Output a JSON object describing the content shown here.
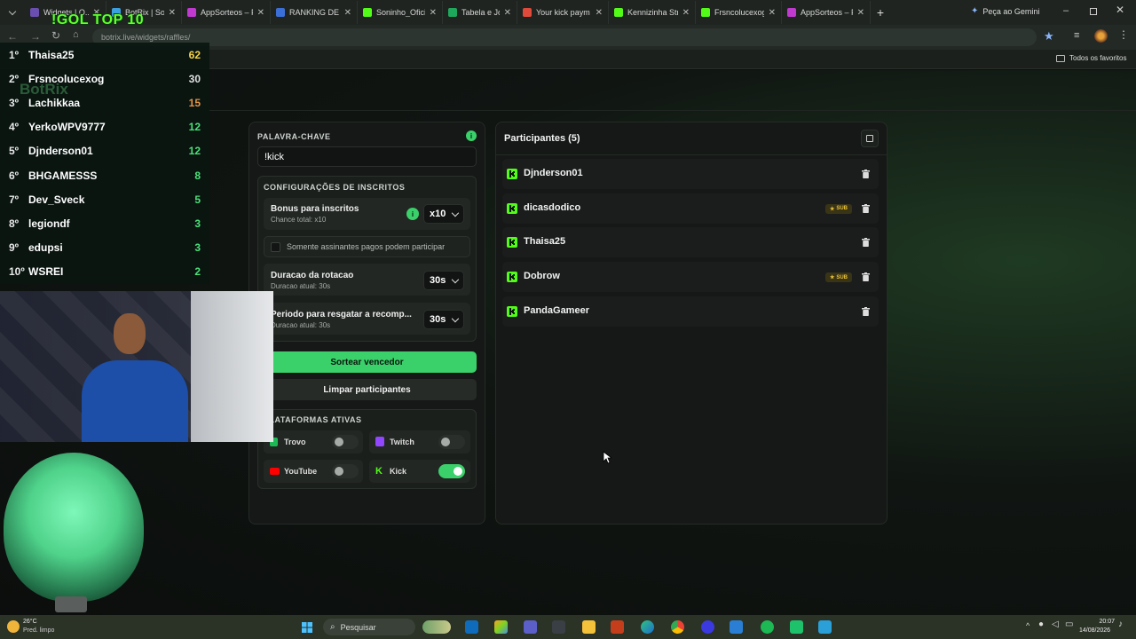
{
  "browser": {
    "tabs": [
      {
        "label": "Widgets | O...",
        "color": "#6a4fb0"
      },
      {
        "label": "BotRix | Sortei",
        "color": "#3aa0e0"
      },
      {
        "label": "AppSorteos – P",
        "color": "#c03ad0"
      },
      {
        "label": "RANKING DE P",
        "color": "#3b6fd8"
      },
      {
        "label": "Soninho_Oficia",
        "color": "#53fc18"
      },
      {
        "label": "Tabela e Jogos",
        "color": "#1ea85c"
      },
      {
        "label": "Your kick paym",
        "color": "#e04a3a"
      },
      {
        "label": "Kennizinha Str",
        "color": "#53fc18"
      },
      {
        "label": "Frsncolucexog",
        "color": "#53fc18"
      },
      {
        "label": "AppSorteos – P",
        "color": "#c03ad0"
      }
    ],
    "new_tab": "+",
    "gemini": "Peça ao Gemini",
    "url": "botrix.live/widgets/raffles/",
    "bookmarks_label": "Todos os favoritos"
  },
  "leaderboard": {
    "title": "!GOL TOP 10",
    "watermark": "BotRix",
    "rows": [
      {
        "rank": "1º",
        "name": "Thaisa25",
        "score": "62",
        "score_color": "#f4d24a"
      },
      {
        "rank": "2º",
        "name": "Frsncolucexog",
        "score": "30",
        "score_color": "#e0e0e0"
      },
      {
        "rank": "3º",
        "name": "Lachikkaa",
        "score": "15",
        "score_color": "#e0954a"
      },
      {
        "rank": "4º",
        "name": "YerkoWPV9777",
        "score": "12",
        "score_color": "#4ce07a"
      },
      {
        "rank": "5º",
        "name": "Djnderson01",
        "score": "12",
        "score_color": "#4ce07a"
      },
      {
        "rank": "6º",
        "name": "BHGAMESSS",
        "score": "8",
        "score_color": "#4ce07a"
      },
      {
        "rank": "7º",
        "name": "Dev_Sveck",
        "score": "5",
        "score_color": "#4ce07a"
      },
      {
        "rank": "8º",
        "name": "legiondf",
        "score": "3",
        "score_color": "#4ce07a"
      },
      {
        "rank": "9º",
        "name": "edupsi",
        "score": "3",
        "score_color": "#4ce07a"
      },
      {
        "rank": "10º",
        "name": "WSREI",
        "score": "2",
        "score_color": "#4ce07a"
      }
    ]
  },
  "config": {
    "keyword_label": "PALAVRA-CHAVE",
    "keyword_value": "!kick",
    "subs_section_title": "CONFIGURAÇÕES DE INSCRITOS",
    "bonus_title": "Bonus para inscritos",
    "bonus_sub": "Chance total: x10",
    "bonus_value": "x10",
    "subs_only_label": "Somente assinantes pagos podem participar",
    "rotation_title": "Duracao da rotacao",
    "rotation_sub": "Duracao atual: 30s",
    "rotation_value": "30s",
    "claim_title": "Periodo para resgatar a recomp...",
    "claim_sub": "Duracao atual: 30s",
    "claim_value": "30s",
    "draw_button": "Sortear vencedor",
    "clear_button": "Limpar participantes",
    "platforms_title": "PLATAFORMAS ATIVAS",
    "platforms": [
      {
        "name": "Trovo",
        "enabled": false,
        "color": "#1db954"
      },
      {
        "name": "Twitch",
        "enabled": false,
        "color": "#9146ff"
      },
      {
        "name": "YouTube",
        "enabled": false,
        "color": "#ff0000"
      },
      {
        "name": "Kick",
        "enabled": true,
        "color": "#53fc18"
      }
    ],
    "accent": "#3ad06a"
  },
  "participants": {
    "title": "Participantes (5)",
    "list": [
      {
        "name": "Djnderson01",
        "sub": false
      },
      {
        "name": "dicasdodico",
        "sub": true
      },
      {
        "name": "Thaisa25",
        "sub": false
      },
      {
        "name": "Dobrow",
        "sub": true
      },
      {
        "name": "PandaGameer",
        "sub": false
      }
    ],
    "sub_badge": "SUB"
  },
  "taskbar": {
    "weather_temp": "26°C",
    "weather_desc": "Pred. limpo",
    "search_placeholder": "Pesquisar",
    "time": "20:07",
    "date": "14/08/2026"
  }
}
